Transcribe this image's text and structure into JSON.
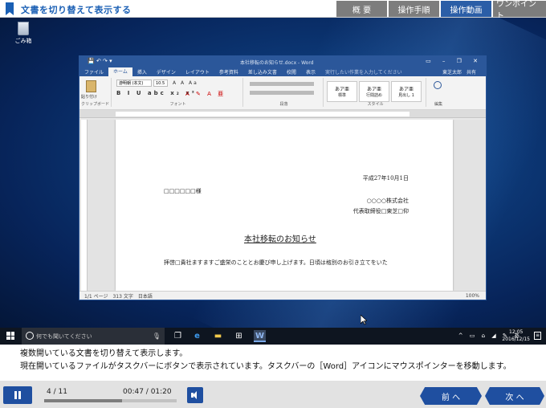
{
  "header": {
    "title": "文書を切り替えて表示する",
    "tabs": [
      {
        "label": "概 要",
        "active": false
      },
      {
        "label": "操作手順",
        "active": false
      },
      {
        "label": "操作動画",
        "active": true
      },
      {
        "label": "ワンポイント",
        "active": false
      }
    ]
  },
  "desktop": {
    "recycle_label": "ごみ箱",
    "word": {
      "doc_title": "本社移転のお知らせ.docx - Word",
      "menu": [
        "ファイル",
        "ホーム",
        "挿入",
        "デザイン",
        "レイアウト",
        "参考資料",
        "差し込み文書",
        "校閲",
        "表示"
      ],
      "tell_me": "実行したい作業を入力してください",
      "user": "東芝太郎",
      "share": "共有",
      "font_name": "游明朝 (本文)",
      "font_size": "10.5",
      "groups": {
        "clipboard": "クリップボード",
        "font": "フォント",
        "paragraph": "段落",
        "styles": "スタイル",
        "edit": "編集"
      },
      "paste_label": "貼り付け",
      "styles": [
        {
          "sample": "あア亜",
          "name": "標準"
        },
        {
          "sample": "あア亜",
          "name": "行間詰め"
        },
        {
          "sample": "あア亜",
          "name": "見出し 1"
        }
      ],
      "document": {
        "date": "平成27年10月1日",
        "addressee": "□□□□□□様",
        "company": "○○○○株式会社",
        "representative": "代表取締役□東芝□仰",
        "heading": "本社移転のお知らせ",
        "body": "拝啓□貴社ますますご盛栄のこととお慶び申し上げます。日頃は格別のお引き立てをいた"
      },
      "status": {
        "page": "1/1 ページ",
        "words": "313 文字",
        "lang": "日本語",
        "zoom": "100%"
      }
    },
    "taskbar": {
      "search_placeholder": "何でも聞いてください",
      "time": "12:05",
      "date": "2016/12/15",
      "ime": "あ"
    }
  },
  "caption": {
    "line1": "複数開いている文書を切り替えて表示します。",
    "line2": "現在開いているファイルがタスクバーにボタンで表示されています。タスクバーの［Word］アイコンにマウスポインターを移動します。"
  },
  "player": {
    "counter": "4 / 11",
    "time": "00:47 / 01:20",
    "progress": 0.5875,
    "prev_label": "前 へ",
    "next_label": "次 へ"
  }
}
